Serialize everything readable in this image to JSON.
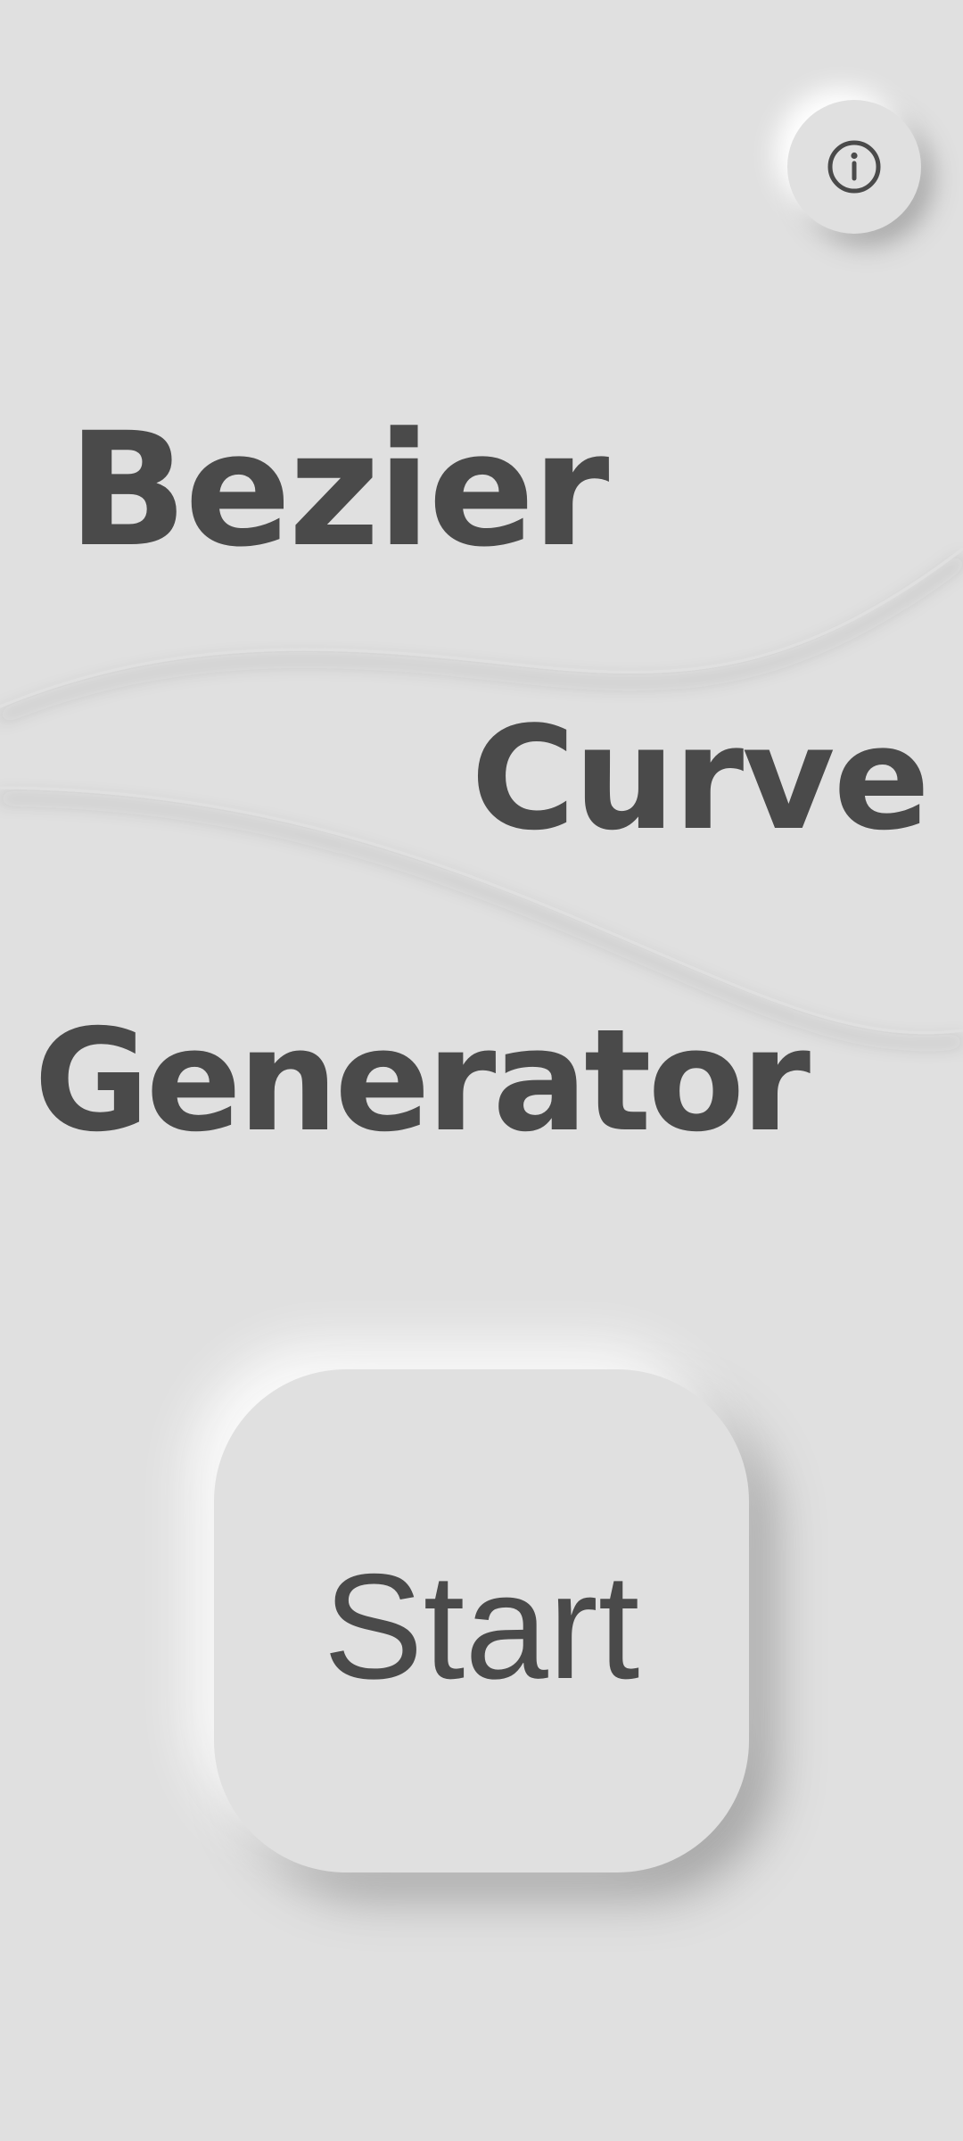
{
  "header": {
    "info_button": {
      "icon": "info-icon"
    }
  },
  "title": {
    "line1": "Bezier",
    "line2": "Curve",
    "line3": "Generator"
  },
  "actions": {
    "start_label": "Start"
  },
  "colors": {
    "background": "#e0e0e0",
    "text": "#4a4a4a",
    "shadow_dark": "#a9a9a9",
    "shadow_light": "#ffffff"
  }
}
